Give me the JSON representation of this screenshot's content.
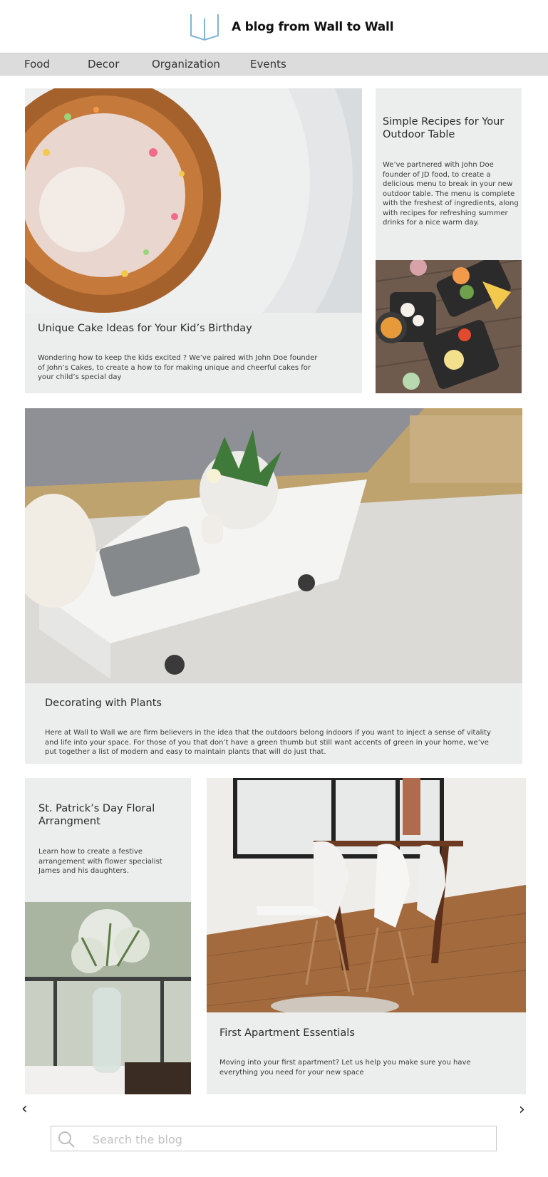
{
  "header": {
    "title": "A blog from Wall to Wall",
    "logo_icon": "wall-logo-icon",
    "brand_color": "#7fb3d5"
  },
  "nav": {
    "items": [
      {
        "label": "Food"
      },
      {
        "label": "Decor"
      },
      {
        "label": "Organization"
      },
      {
        "label": "Events"
      }
    ]
  },
  "posts": {
    "cake": {
      "title": "Unique Cake Ideas for Your Kid’s Birthday",
      "description": "Wondering how to keep the kids excited ? We’ve paired with John Doe founder of John’s Cakes, to create a how to for making unique and cheerful cakes for your child’s special day"
    },
    "recipes": {
      "title": "Simple Recipes for Your Outdoor Table",
      "description": "We’ve partnered with John Doe founder of JD food, to create a delicious menu to break in your new outdoor table. The menu is complete with the freshest of ingredients, along with recipes for refreshing summer drinks for a nice warm day."
    },
    "plants": {
      "title": "Decorating with Plants",
      "description": "Here at Wall to Wall we are firm believers in the idea that the outdoors belong indoors if you want to inject a sense of vitality and life into your space. For those of you that don’t have a green thumb but still want accents of green in your home, we’ve put together a list of modern and easy to maintain plants that will do just that."
    },
    "floral": {
      "title": "St. Patrick’s Day Floral Arrangment",
      "description": "Learn how to create a festive arrangement with flower specialist James and his daughters."
    },
    "apartment": {
      "title": "First Apartment Essentials",
      "description": "Moving into your first apartment? Let us help you make sure you have everything you need for your new space"
    }
  },
  "pagination": {
    "prev": "‹",
    "next": "›"
  },
  "search": {
    "placeholder": "Search the blog",
    "value": ""
  },
  "colors": {
    "card_background": "#eceeed",
    "nav_background": "#dcdcdc"
  }
}
